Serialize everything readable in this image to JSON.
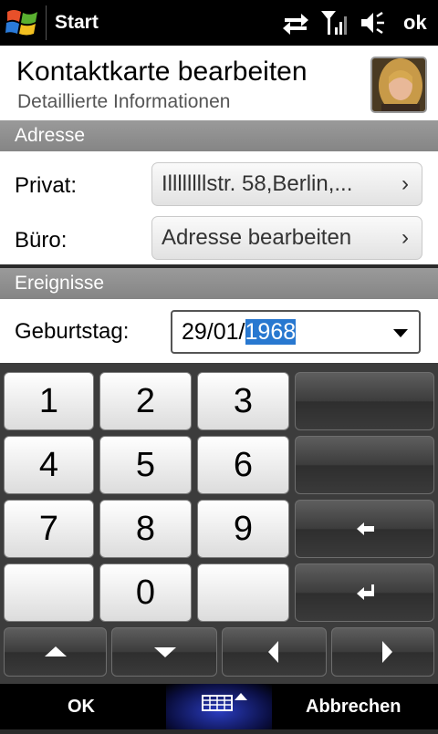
{
  "statusbar": {
    "title": "Start",
    "ok_label": "ok",
    "icons": [
      "windows-logo",
      "data-transfer-icon",
      "signal-icon",
      "volume-icon"
    ]
  },
  "header": {
    "title": "Kontaktkarte bearbeiten",
    "subtitle": "Detaillierte Informationen"
  },
  "sections": {
    "address": "Adresse",
    "events": "Ereignisse"
  },
  "address": {
    "private_label": "Privat:",
    "private_value": "Illllllllstr. 58,Berlin,...",
    "office_label": "Büro:",
    "office_value": "Adresse bearbeiten"
  },
  "events": {
    "birthday_label": "Geburtstag:",
    "birthday_prefix": "29/01/",
    "birthday_selected": "1968"
  },
  "keypad": {
    "keys": [
      "1",
      "2",
      "3",
      "4",
      "5",
      "6",
      "7",
      "8",
      "9",
      "0"
    ]
  },
  "bottombar": {
    "left": "OK",
    "right": "Abbrechen"
  },
  "colors": {
    "selection": "#2878d0",
    "section_bar": "#8a8a8a",
    "keypad_bg": "#3c3c3c"
  }
}
